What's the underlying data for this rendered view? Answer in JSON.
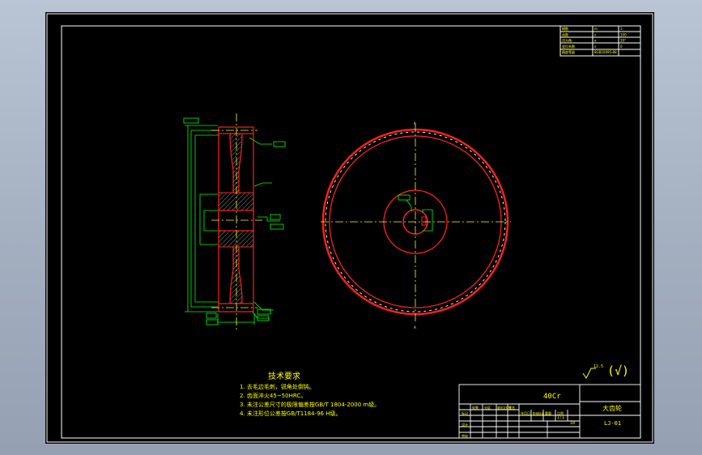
{
  "colors": {
    "background": "#000000",
    "frame": "#ffffff",
    "gear_outline": "#ff2020",
    "dimension": "#00ff00",
    "centerline": "#ffff00",
    "text": "#ffff00",
    "hatch": "#ffffff"
  },
  "tech_requirements": {
    "title": "技术要求",
    "items": [
      "1. 去毛边毛刺，锐角处倒钝。",
      "2. 齿面淬火45~50HRC。",
      "3. 未注公差尺寸的极限偏差按GB/T 1804-2000 m级。",
      "4. 未注形位公差按GB/T1184-96 H级。"
    ]
  },
  "roughness_note": {
    "value": "12.5",
    "symbol": "(√)"
  },
  "title_block": {
    "material": "40Cr",
    "part_name": "大齿轮",
    "drawing_no": "LJ-01",
    "scale": "1:1",
    "sheet": "10",
    "row_labels": [
      "标记",
      "设计",
      "审核"
    ],
    "col_labels": [
      "处数",
      "分区",
      "更改文件号",
      "签名",
      "年月日",
      "阶段标记",
      "重量",
      "比例"
    ]
  },
  "param_table": {
    "rows": [
      [
        "模数",
        "m",
        "3"
      ],
      [
        "齿数",
        "z",
        "100"
      ],
      [
        "压力角",
        "α",
        "20°"
      ],
      [
        "变位系数",
        "x",
        "0"
      ],
      [
        "精度等级",
        "8GB10095-88",
        ""
      ]
    ]
  },
  "view_labels": {
    "top": "A",
    "bottom": "A"
  }
}
